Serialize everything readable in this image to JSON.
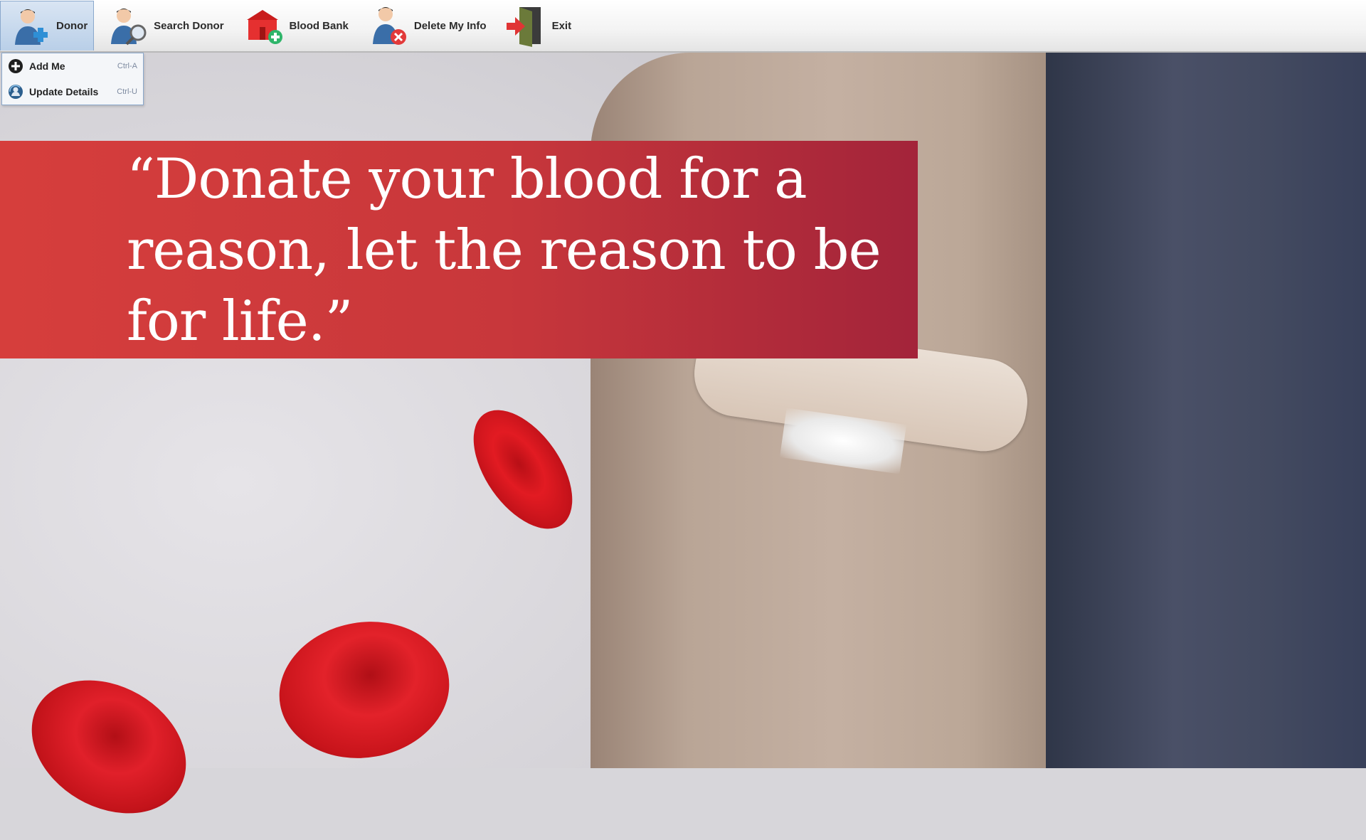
{
  "toolbar": {
    "items": [
      {
        "label": "Donor",
        "icon": "donor-add-icon",
        "active": true
      },
      {
        "label": "Search Donor",
        "icon": "search-donor-icon"
      },
      {
        "label": "Blood Bank",
        "icon": "blood-bank-icon"
      },
      {
        "label": "Delete My Info",
        "icon": "delete-user-icon"
      },
      {
        "label": "Exit",
        "icon": "exit-door-icon"
      }
    ]
  },
  "donor_menu": {
    "items": [
      {
        "label": "Add Me",
        "shortcut": "Ctrl-A",
        "icon": "plus-circle-icon"
      },
      {
        "label": "Update Details",
        "shortcut": "Ctrl-U",
        "icon": "update-user-icon"
      }
    ]
  },
  "banner": {
    "quote": "“Donate your blood for a reason, let the reason to be for life.”"
  },
  "colors": {
    "banner_start": "#d63e3c",
    "banner_end": "#a3243a",
    "toolbar_active": "#b9cfe8"
  }
}
